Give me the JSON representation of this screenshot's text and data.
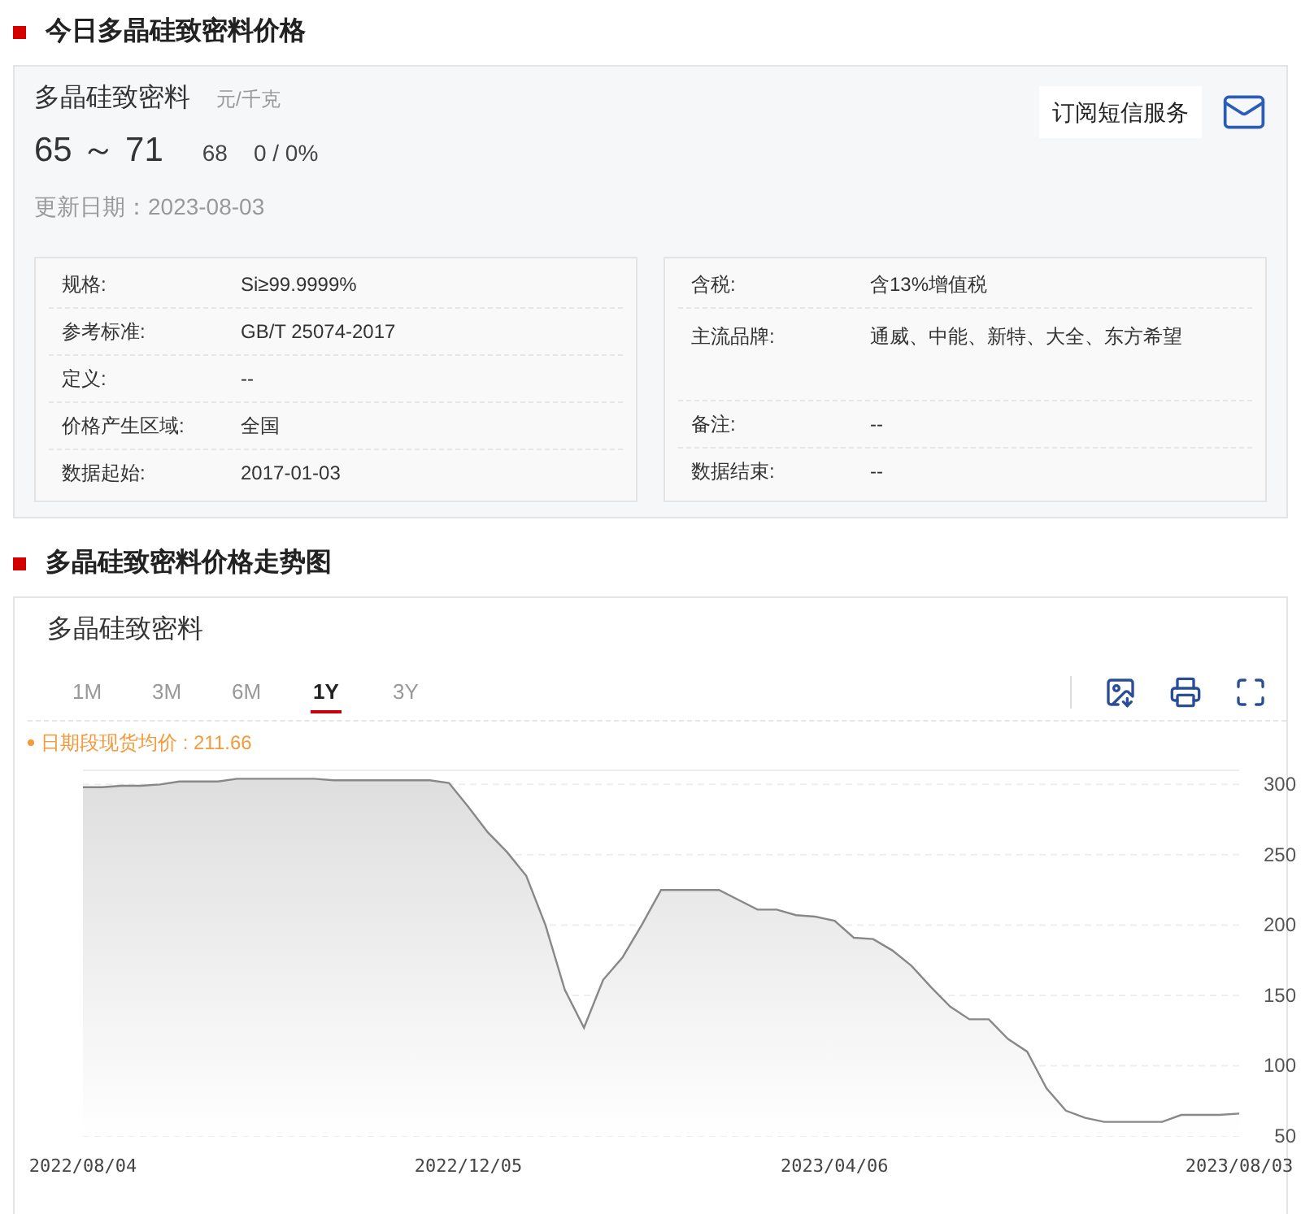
{
  "price_section": {
    "heading": "今日多晶硅致密料价格",
    "product": "多晶硅致密料",
    "unit": "元/千克",
    "range": "65 ～ 71",
    "average": "68",
    "change": "0 / 0%",
    "updated": "更新日期：2023-08-03",
    "subscribe": "订阅短信服务",
    "specs_left": [
      {
        "label": "规格:",
        "value": "Si≥99.9999%"
      },
      {
        "label": "参考标准:",
        "value": "GB/T 25074-2017"
      },
      {
        "label": "定义:",
        "value": "--"
      },
      {
        "label": "价格产生区域:",
        "value": "全国"
      },
      {
        "label": "数据起始:",
        "value": "2017-01-03"
      }
    ],
    "specs_right": [
      {
        "label": "含税:",
        "value": "含13%增值税"
      },
      {
        "label": "主流品牌:",
        "value": "通威、中能、新特、大全、东方希望"
      },
      {
        "label": "备注:",
        "value": "--"
      },
      {
        "label": "数据结束:",
        "value": "--"
      }
    ]
  },
  "trend_section": {
    "heading": "多晶硅致密料价格走势图",
    "title": "多晶硅致密料",
    "ranges": [
      {
        "label": "1M",
        "selected": false
      },
      {
        "label": "3M",
        "selected": false
      },
      {
        "label": "6M",
        "selected": false
      },
      {
        "label": "1Y",
        "selected": true
      },
      {
        "label": "3Y",
        "selected": false
      }
    ],
    "average_note": "日期段现货均价 : 211.66",
    "chart_data": {
      "type": "area",
      "categories": [
        "2022/08/04",
        null,
        null,
        null,
        null,
        null,
        null,
        null,
        null,
        null,
        null,
        null,
        null,
        null,
        null,
        null,
        null,
        null,
        null,
        null,
        "2022/12/05",
        null,
        null,
        null,
        null,
        null,
        null,
        null,
        null,
        null,
        null,
        null,
        null,
        null,
        null,
        null,
        null,
        null,
        null,
        "2023/04/06",
        null,
        null,
        null,
        null,
        null,
        null,
        null,
        null,
        null,
        null,
        null,
        null,
        null,
        null,
        null,
        null,
        null,
        null,
        null,
        null,
        "2023/08/03"
      ],
      "series": [
        {
          "color": "#888888",
          "values": [
            298,
            298,
            299,
            299,
            300,
            302,
            302,
            302,
            304,
            304,
            304,
            304,
            304,
            303,
            303,
            303,
            303,
            303,
            303,
            301,
            284,
            266,
            252,
            235,
            200,
            154,
            127,
            161,
            177,
            200,
            225,
            225,
            225,
            225,
            218,
            211,
            211,
            207,
            206,
            203,
            191,
            190,
            182,
            171,
            156,
            142,
            133,
            133,
            119,
            110,
            84,
            68,
            63,
            60,
            60,
            60,
            60,
            65,
            65,
            65,
            66
          ]
        }
      ],
      "grid": true,
      "ylim": [
        50,
        310
      ],
      "yticks": [
        50,
        100,
        150,
        200,
        250,
        300
      ]
    }
  }
}
